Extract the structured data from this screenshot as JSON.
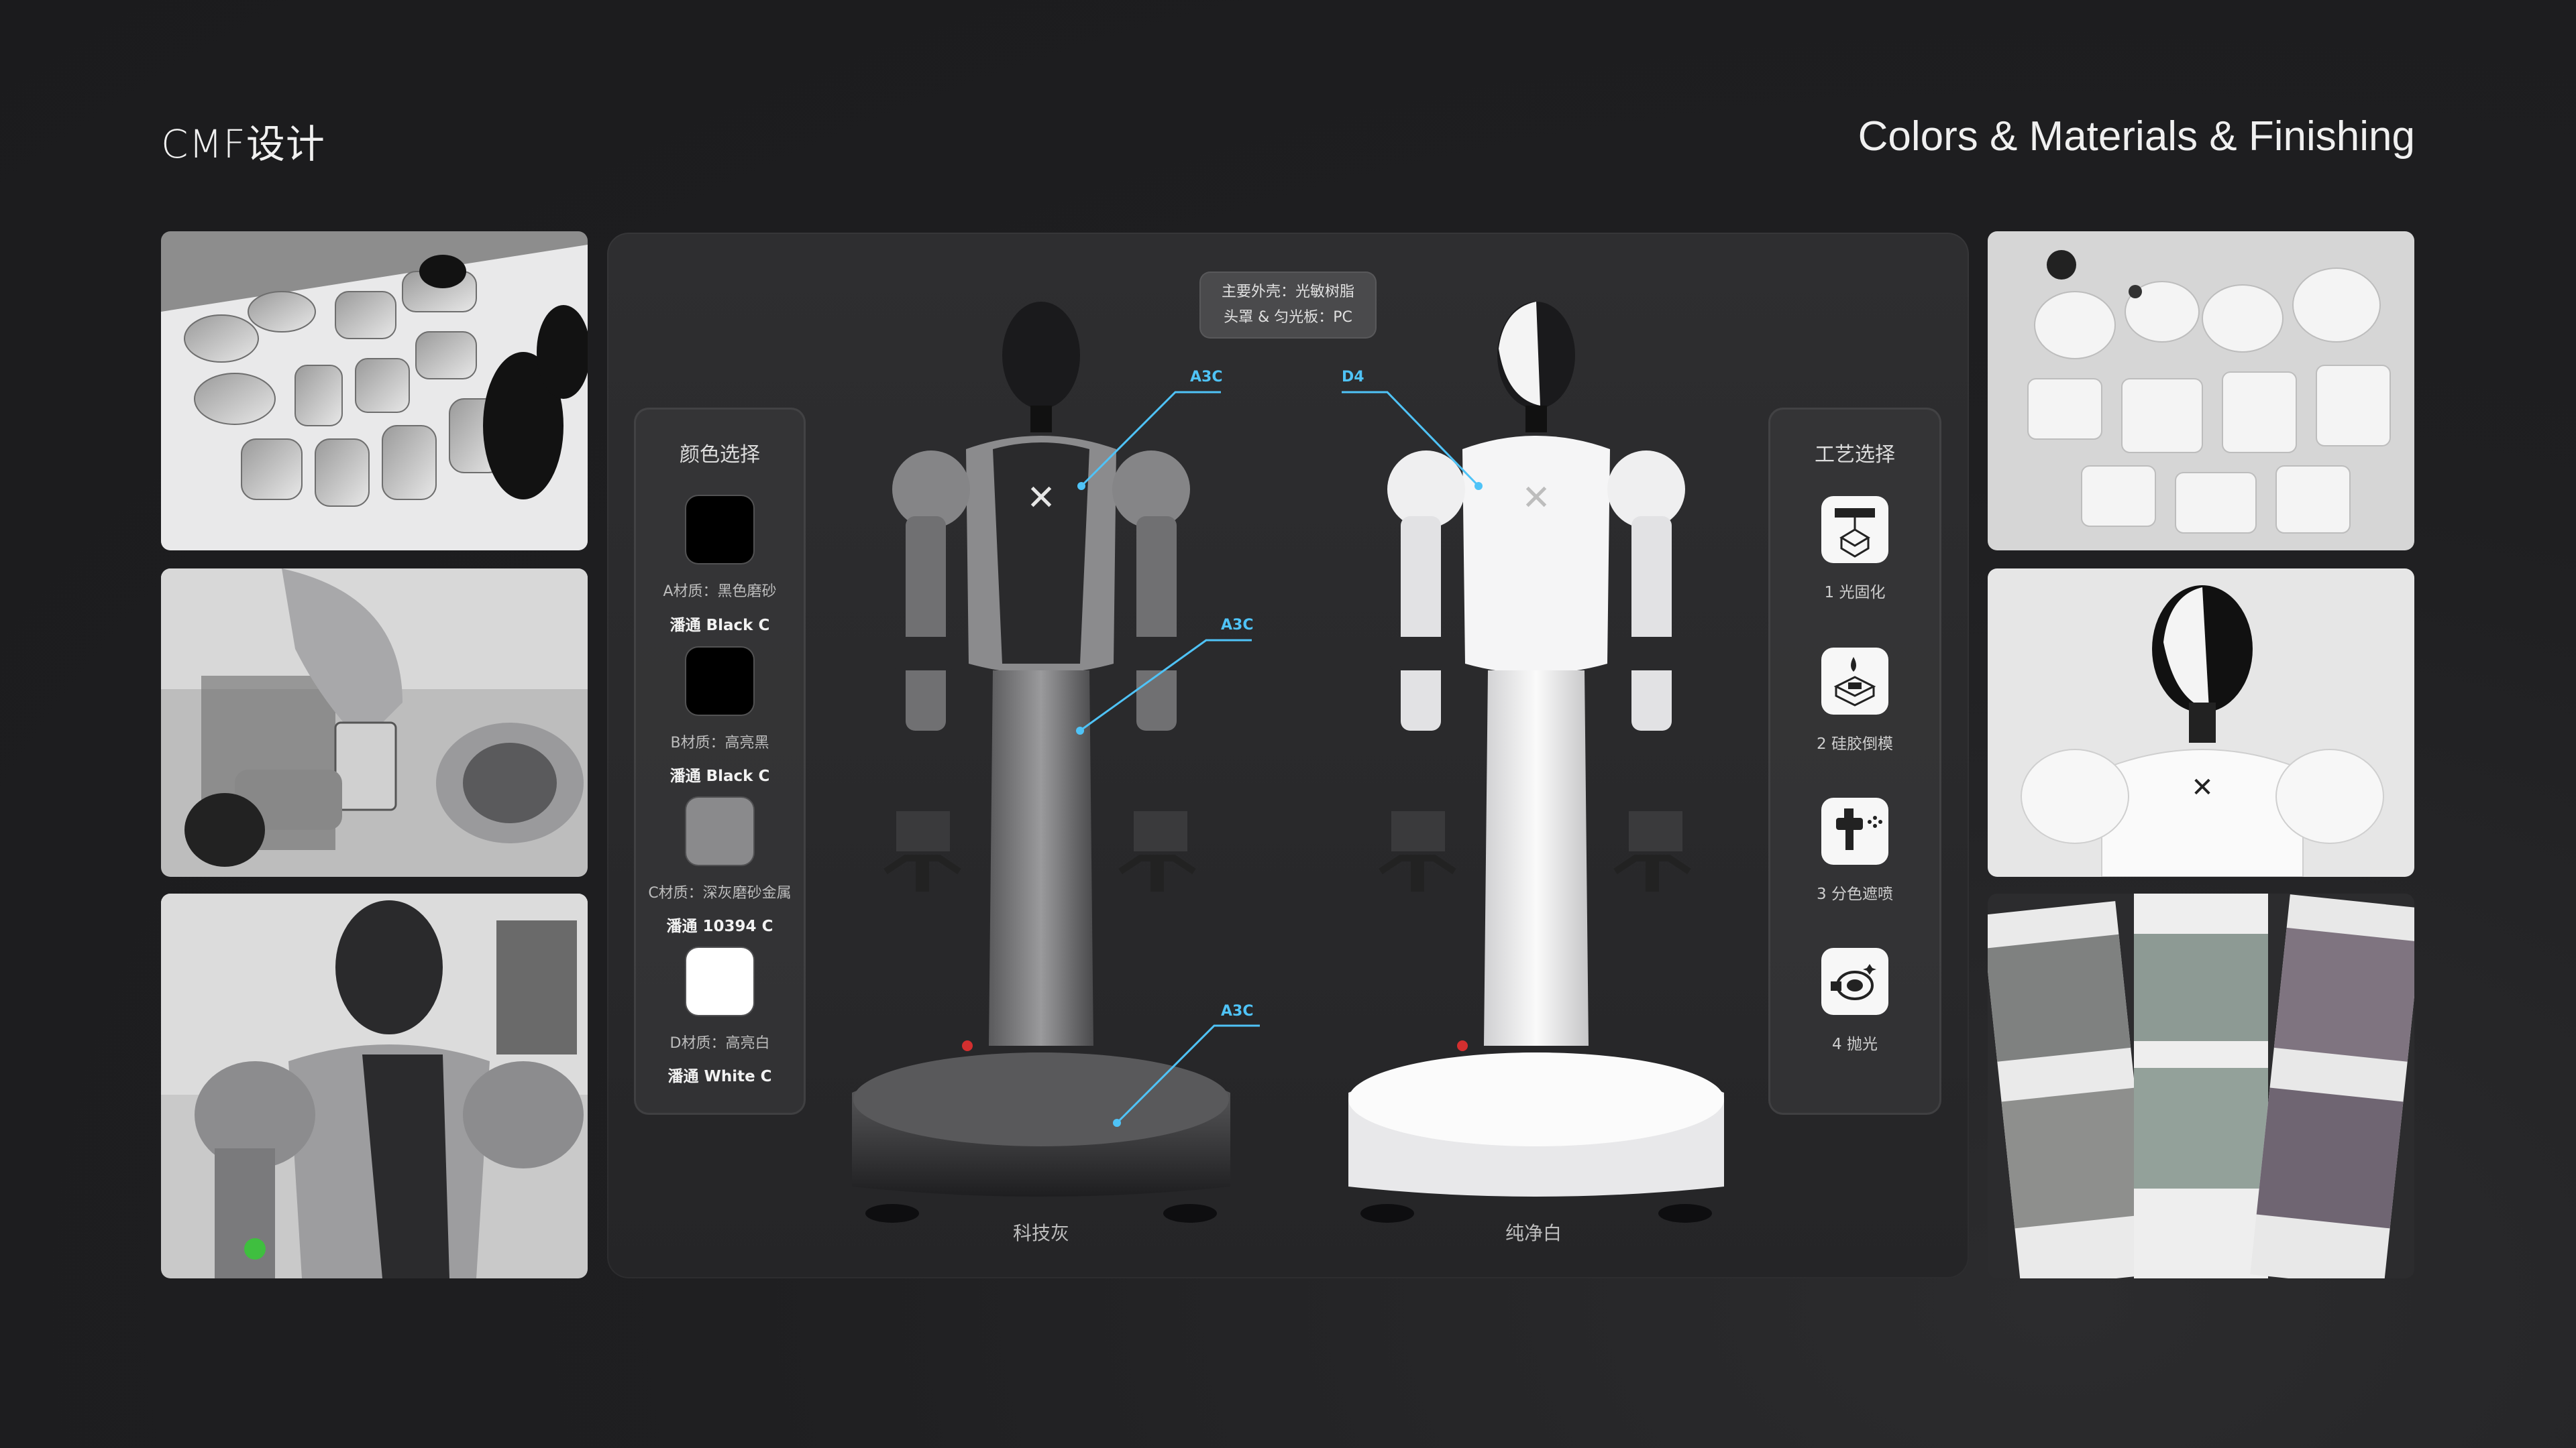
{
  "header": {
    "title_left": "CMF设计",
    "title_right": "Colors & Materials & Finishing"
  },
  "color_panel": {
    "title": "颜色选择",
    "items": [
      {
        "label": "A材质：黑色磨砂",
        "code": "潘通 Black C",
        "color": "#000000"
      },
      {
        "label": "B材质：高亮黑",
        "code": "潘通 Black C",
        "color": "#000000"
      },
      {
        "label": "C材质：深灰磨砂金属",
        "code": "潘通 10394 C",
        "color": "#8a8a8c"
      },
      {
        "label": "D材质：高亮白",
        "code": "潘通 White C",
        "color": "#ffffff"
      }
    ]
  },
  "process_panel": {
    "title": "工艺选择",
    "items": [
      {
        "label": "1 光固化",
        "icon": "uv-curing-icon"
      },
      {
        "label": "2 硅胶倒模",
        "icon": "silicone-mold-icon"
      },
      {
        "label": "3  分色遮喷",
        "icon": "spray-gun-icon"
      },
      {
        "label": "4 抛光",
        "icon": "polishing-icon"
      }
    ]
  },
  "tooltip": {
    "line1": "主要外壳：光敏树脂",
    "line2": "头罩 & 匀光板：PC"
  },
  "callouts": {
    "a3c_1": "A3C",
    "a3c_2": "A3C",
    "a3c_3": "A3C",
    "d4": "D4"
  },
  "variants": {
    "left": "科技灰",
    "right": "纯净白"
  },
  "colors": {
    "accent": "#4fc3f7",
    "background": "#1e1e20",
    "panel": "#2b2b2d"
  }
}
